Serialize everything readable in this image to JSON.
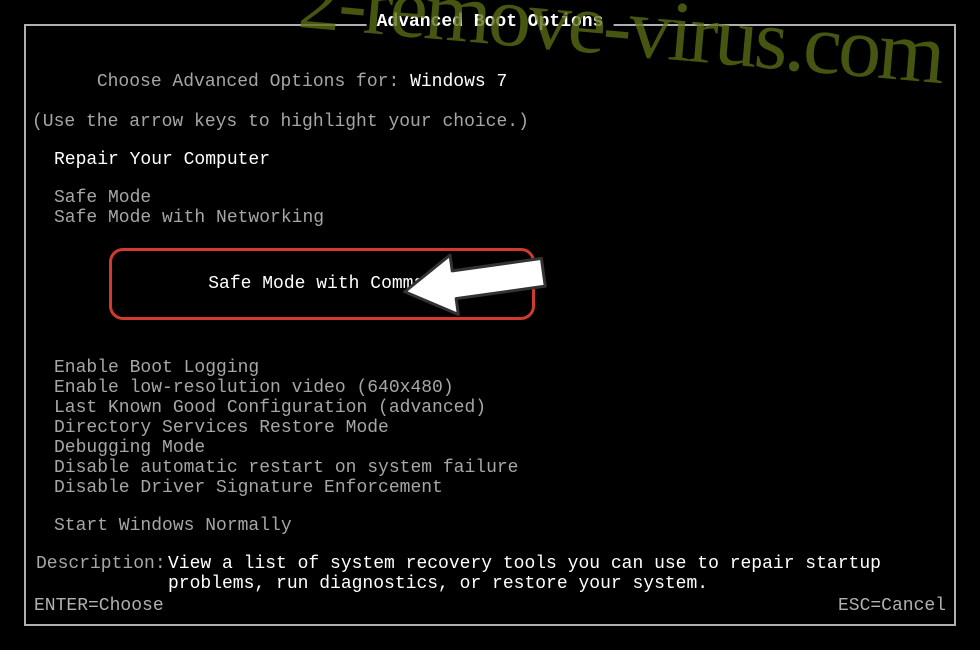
{
  "title": "Advanced Boot Options",
  "choose_prefix": "Choose Advanced Options for: ",
  "os_name": "Windows 7",
  "hint": "(Use the arrow keys to highlight your choice.)",
  "groups": {
    "repair": "Repair Your Computer",
    "safe": [
      "Safe Mode",
      "Safe Mode with Networking",
      "Safe Mode with Command Prompt"
    ],
    "advanced": [
      "Enable Boot Logging",
      "Enable low-resolution video (640x480)",
      "Last Known Good Configuration (advanced)",
      "Directory Services Restore Mode",
      "Debugging Mode",
      "Disable automatic restart on system failure",
      "Disable Driver Signature Enforcement"
    ],
    "normal": "Start Windows Normally"
  },
  "description": {
    "label": "Description:",
    "text": "View a list of system recovery tools you can use to repair startup problems, run diagnostics, or restore your system."
  },
  "footer": {
    "enter": "ENTER=Choose",
    "esc": "ESC=Cancel"
  },
  "watermark": "2-remove-virus.com"
}
